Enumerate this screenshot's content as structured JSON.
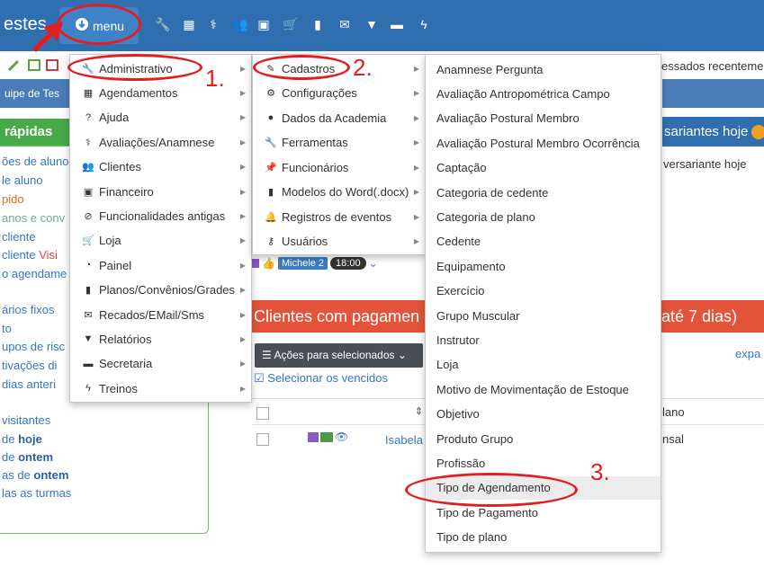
{
  "topnav": {
    "brand": "estes",
    "menu_label": "menu",
    "icons": [
      "wrench-icon",
      "calendar-icon",
      "stethoscope-icon",
      "users-icon",
      "money-icon",
      "cart-icon",
      "file-icon",
      "envelope-icon",
      "filter-icon",
      "desk-icon",
      "bolt-icon"
    ]
  },
  "background": {
    "processed_text": "essados recenteme",
    "team_text": "uipe de Tes",
    "quick_text": "rápidas",
    "anniv_title": "sariantes hoje",
    "anniv_line": "versariante hoje",
    "left_links": [
      {
        "text": "ões de aluno"
      },
      {
        "text": "le aluno"
      },
      {
        "text": "pido"
      },
      {
        "text": "anos e conv"
      },
      {
        "text": "cliente"
      },
      {
        "text": "cliente ",
        "extra": "Visi"
      },
      {
        "text": "o agendame"
      },
      {
        "text": "ários fixos"
      },
      {
        "text": "to"
      },
      {
        "text": "upos de risc"
      },
      {
        "text": "tivações di"
      },
      {
        "text": "dias anteri"
      },
      {
        "text": "visitantes"
      },
      {
        "text": "de ",
        "bold": "hoje"
      },
      {
        "text": "de ",
        "bold": "ontem"
      },
      {
        "text": "as de ",
        "bold": "ontem"
      },
      {
        "text": "las as turmas"
      }
    ],
    "tag_name": "Michele 2",
    "tag_time": "18:00",
    "clients_title": "Clientes com pagamen",
    "clients_title_right": "até 7 dias)",
    "actions_label": "Ações para selecionados",
    "select_expired": "Selecionar os vencidos",
    "expand_link": "expa",
    "plano_header": "lano",
    "row_name": "Isabela",
    "row_plano": "nsal"
  },
  "menu_level1": [
    {
      "icon": "wrench-icon",
      "glyph": "🔧",
      "label": "Administrativo"
    },
    {
      "icon": "calendar-icon",
      "glyph": "▦",
      "label": "Agendamentos"
    },
    {
      "icon": "question-icon",
      "glyph": "?",
      "label": "Ajuda"
    },
    {
      "icon": "stethoscope-icon",
      "glyph": "⚕",
      "label": "Avaliações/Anamnese"
    },
    {
      "icon": "users-icon",
      "glyph": "👥",
      "label": "Clientes"
    },
    {
      "icon": "money-icon",
      "glyph": "▣",
      "label": "Financeiro"
    },
    {
      "icon": "ban-icon",
      "glyph": "⊘",
      "label": "Funcionalidades antigas"
    },
    {
      "icon": "cart-icon",
      "glyph": "🛒",
      "label": "Loja"
    },
    {
      "icon": "dashboard-icon",
      "glyph": "◔",
      "label": "Painel"
    },
    {
      "icon": "file-icon",
      "glyph": "▮",
      "label": "Planos/Convênios/Grades"
    },
    {
      "icon": "envelope-icon",
      "glyph": "✉",
      "label": "Recados/EMail/Sms"
    },
    {
      "icon": "filter-icon",
      "glyph": "▼",
      "label": "Relatórios"
    },
    {
      "icon": "desk-icon",
      "glyph": "▬",
      "label": "Secretaria"
    },
    {
      "icon": "bolt-icon",
      "glyph": "ϟ",
      "label": "Treinos"
    }
  ],
  "menu_level2": [
    {
      "icon": "edit-icon",
      "glyph": "✎",
      "label": "Cadastros"
    },
    {
      "icon": "gear-icon",
      "glyph": "⚙",
      "label": "Configurações"
    },
    {
      "icon": "database-icon",
      "glyph": "●",
      "label": "Dados da Academia"
    },
    {
      "icon": "wrench-icon",
      "glyph": "🔧",
      "label": "Ferramentas"
    },
    {
      "icon": "pushpin-icon",
      "glyph": "📌",
      "label": "Funcionários"
    },
    {
      "icon": "file-icon",
      "glyph": "▮",
      "label": "Modelos do Word(.docx)"
    },
    {
      "icon": "bell-icon",
      "glyph": "🔔",
      "label": "Registros de eventos"
    },
    {
      "icon": "user-key-icon",
      "glyph": "⚷",
      "label": "Usuários"
    }
  ],
  "menu_level3": [
    "Anamnese Pergunta",
    "Avaliação Antropométrica Campo",
    "Avaliação Postural Membro",
    "Avaliação Postural Membro Ocorrência",
    "Captação",
    "Categoria de cedente",
    "Categoria de plano",
    "Cedente",
    "Equipamento",
    "Exercício",
    "Grupo Muscular",
    "Instrutor",
    "Loja",
    "Motivo de Movimentação de Estoque",
    "Objetivo",
    "Produto Grupo",
    "Profissão",
    "Tipo de Agendamento",
    "Tipo de Pagamento",
    "Tipo de plano"
  ],
  "annotations": {
    "step1": "1.",
    "step2": "2.",
    "step3": "3.",
    "color": "#e02020"
  },
  "colors": {
    "nav_bg": "#2f6fb0",
    "highlight": "#ececec"
  }
}
